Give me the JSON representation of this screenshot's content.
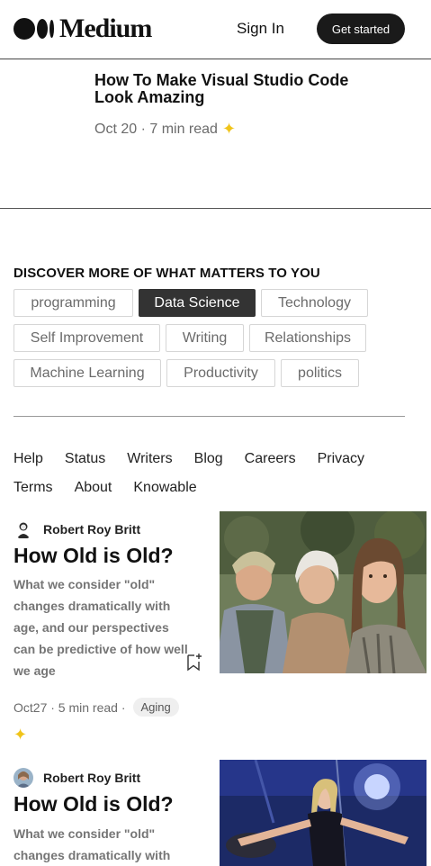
{
  "header": {
    "logo_text": "Medium",
    "signin_label": "Sign In",
    "getstarted_label": "Get started"
  },
  "top_article": {
    "title": "How To Make Visual Studio Code Look Amazing",
    "meta": "Oct 20 · 7 min read",
    "member_icon": "star-icon"
  },
  "discover": {
    "title": "DISCOVER MORE OF WHAT MATTERS TO YOU",
    "tags": [
      {
        "label": "programming",
        "active": false
      },
      {
        "label": "Data Science",
        "active": true
      },
      {
        "label": "Technology",
        "active": false
      },
      {
        "label": "Self Improvement",
        "active": false
      },
      {
        "label": "Writing",
        "active": false
      },
      {
        "label": "Relationships",
        "active": false
      },
      {
        "label": "Machine Learning",
        "active": false
      },
      {
        "label": "Productivity",
        "active": false
      },
      {
        "label": "politics",
        "active": false
      }
    ]
  },
  "footer_links": [
    "Help",
    "Status",
    "Writers",
    "Blog",
    "Careers",
    "Privacy",
    "Terms",
    "About",
    "Knowable"
  ],
  "feed": [
    {
      "author": "Robert Roy Britt",
      "title": "How Old is Old?",
      "subtitle": "What we consider \"old\" changes dramatically with age, and our perspectives can be predictive of how well we age",
      "meta": "Oct27 · 5 min read ·",
      "tag": "Aging"
    },
    {
      "author": "Robert Roy Britt",
      "title": "How Old is Old?",
      "subtitle": "What we consider \"old\" changes dramatically with"
    }
  ],
  "colors": {
    "accent_dark": "#1a1a1a",
    "star": "#f0c419",
    "muted_text": "#6b6b6b"
  }
}
